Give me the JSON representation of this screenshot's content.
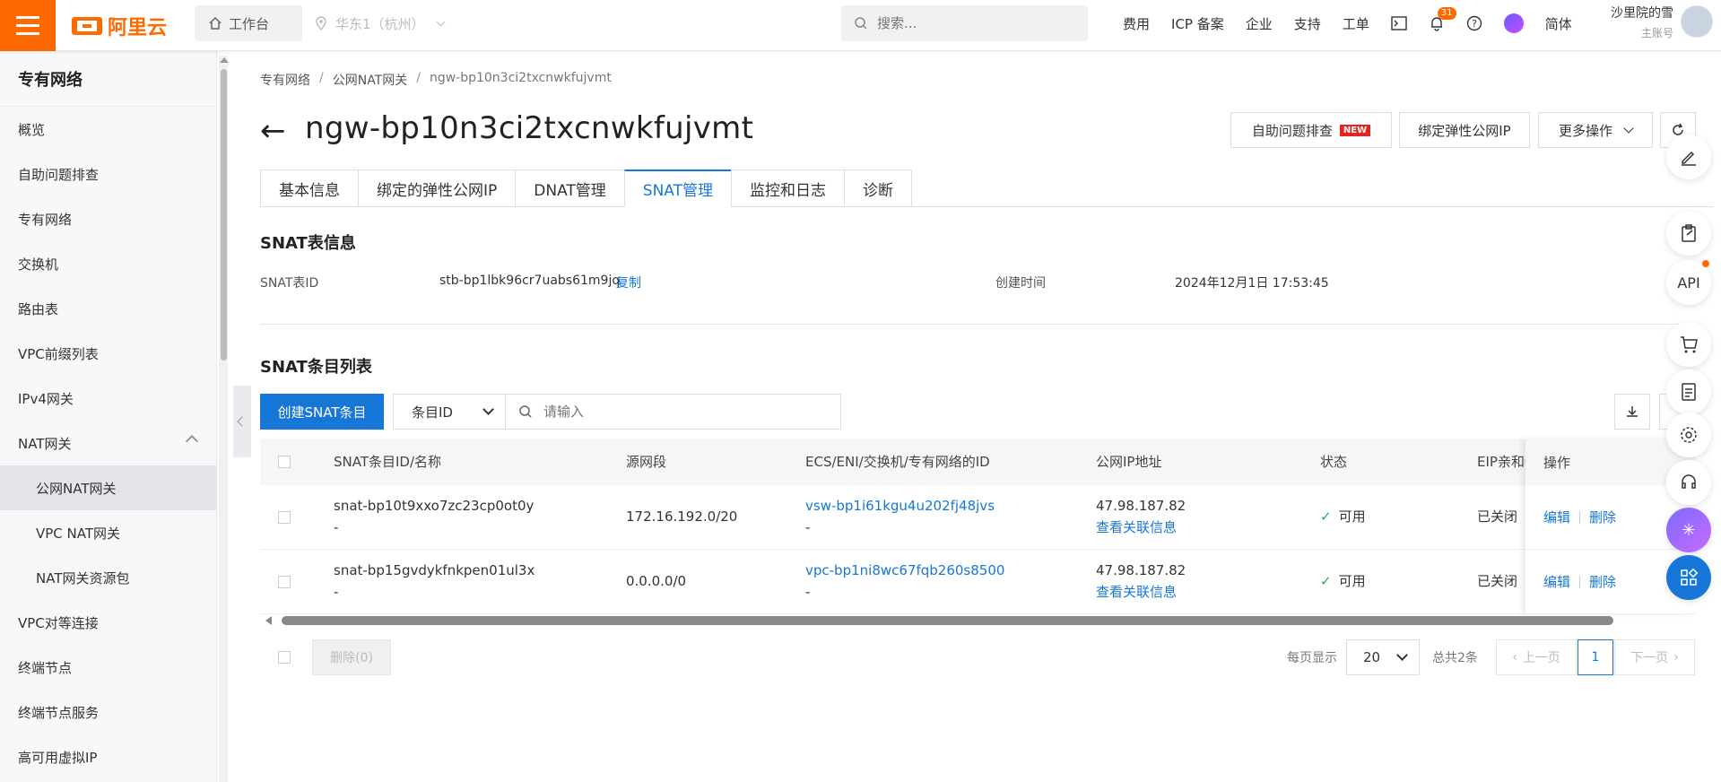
{
  "topbar": {
    "brand": "阿里云",
    "workbench": "工作台",
    "region": "华东1（杭州）",
    "search_placeholder": "搜索...",
    "nav": [
      "费用",
      "ICP 备案",
      "企业",
      "支持",
      "工单"
    ],
    "notification_count": "31",
    "language": "简体",
    "user_name": "沙里院的雪",
    "user_role": "主账号"
  },
  "sidebar": {
    "title": "专有网络",
    "items": [
      {
        "label": "概览"
      },
      {
        "label": "自助问题排查"
      },
      {
        "label": "专有网络"
      },
      {
        "label": "交换机"
      },
      {
        "label": "路由表"
      },
      {
        "label": "VPC前缀列表"
      },
      {
        "label": "IPv4网关"
      },
      {
        "label": "NAT网关"
      },
      {
        "label": "公网NAT网关"
      },
      {
        "label": "VPC NAT网关"
      },
      {
        "label": "NAT网关资源包"
      },
      {
        "label": "VPC对等连接"
      },
      {
        "label": "终端节点"
      },
      {
        "label": "终端节点服务"
      },
      {
        "label": "高可用虚拟IP"
      }
    ]
  },
  "breadcrumb": {
    "l1": "专有网络",
    "l2": "公网NAT网关",
    "l3": "ngw-bp10n3ci2txcnwkfujvmt"
  },
  "page": {
    "back": "←",
    "title": "ngw-bp10n3ci2txcnwkfujvmt",
    "btn_troubleshoot": "自助问题排查",
    "new_tag": "NEW",
    "btn_bind_eip": "绑定弹性公网IP",
    "btn_more": "更多操作"
  },
  "tabs": [
    "基本信息",
    "绑定的弹性公网IP",
    "DNAT管理",
    "SNAT管理",
    "监控和日志",
    "诊断"
  ],
  "snat_info": {
    "title": "SNAT表信息",
    "id_label": "SNAT表ID",
    "id_value": "stb-bp1lbk96cr7uabs61m9jq",
    "copy": "复制",
    "time_label": "创建时间",
    "time_value": "2024年12月1日 17:53:45"
  },
  "snat_list": {
    "title": "SNAT条目列表",
    "create_btn": "创建SNAT条目",
    "filter_select": "条目ID",
    "search_placeholder": "请输入",
    "columns": [
      "SNAT条目ID/名称",
      "源网段",
      "ECS/ENI/交换机/专有网络的ID",
      "公网IP地址",
      "状态",
      "EIP亲和性",
      "操作"
    ],
    "rows": [
      {
        "id": "snat-bp10t9xxo7zc23cp0ot0y",
        "name": "-",
        "source": "172.16.192.0/20",
        "resource": "vsw-bp1i61kgu4u202fj48jvs",
        "resource_sub": "-",
        "ip": "47.98.187.82",
        "ip_link": "查看关联信息",
        "status": "可用",
        "affinity": "已关闭",
        "edit": "编辑",
        "delete": "删除"
      },
      {
        "id": "snat-bp15gvdykfnkpen01ul3x",
        "name": "-",
        "source": "0.0.0.0/0",
        "resource": "vpc-bp1ni8wc67fqb260s8500",
        "resource_sub": "-",
        "ip": "47.98.187.82",
        "ip_link": "查看关联信息",
        "status": "可用",
        "affinity": "已关闭",
        "edit": "编辑",
        "delete": "删除"
      }
    ]
  },
  "footer": {
    "delete_btn": "删除(0)",
    "per_page_label": "每页显示",
    "per_page": "20",
    "total": "总共2条",
    "prev": "上一页",
    "current": "1",
    "next": "下一页"
  },
  "colors": {
    "accent": "#ff6a00",
    "link": "#1677d8",
    "success": "#2fa84f"
  }
}
